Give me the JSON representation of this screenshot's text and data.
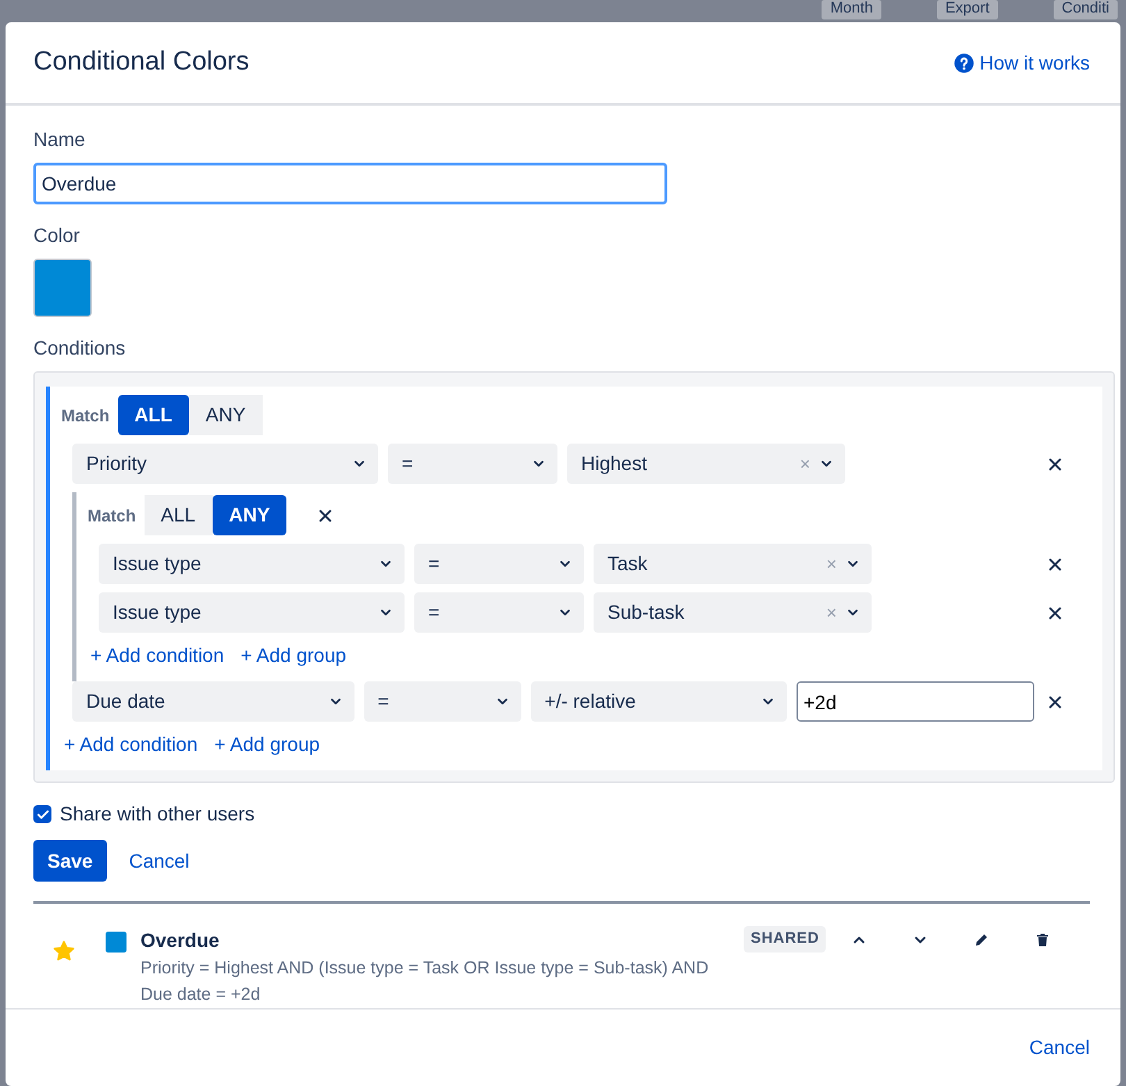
{
  "backdrop": {
    "toolbar": [
      "Month",
      "Export",
      "Conditi"
    ]
  },
  "dialog": {
    "title": "Conditional Colors",
    "help_link": "How it works"
  },
  "form": {
    "name_label": "Name",
    "name_value": "Overdue",
    "color_label": "Color",
    "color": "#0089d6",
    "conditions_label": "Conditions"
  },
  "group": {
    "match_label": "Match",
    "match_options": [
      {
        "label": "ALL",
        "selected": true
      },
      {
        "label": "ANY",
        "selected": false
      }
    ],
    "items": [
      {
        "kind": "condition",
        "field": "Priority",
        "operator": "=",
        "value": "Highest",
        "clear_icon": "×"
      },
      {
        "kind": "group",
        "match_label": "Match",
        "match_options": [
          {
            "label": "ALL",
            "selected": false
          },
          {
            "label": "ANY",
            "selected": true
          }
        ],
        "removable": true,
        "items": [
          {
            "kind": "condition",
            "field": "Issue type",
            "operator": "=",
            "value": "Task",
            "clear_icon": "×"
          },
          {
            "kind": "condition",
            "field": "Issue type",
            "operator": "=",
            "value": "Sub-task",
            "clear_icon": "×"
          }
        ],
        "add_condition": "+ Add condition",
        "add_group": "+ Add group"
      },
      {
        "kind": "condition",
        "field": "Due date",
        "operator": "=",
        "value": "+/- relative",
        "extra_input": "+2d"
      }
    ],
    "add_condition": "+ Add condition",
    "add_group": "+ Add group"
  },
  "share": {
    "label": "Share with other users",
    "checked": true
  },
  "actions": {
    "save": "Save",
    "cancel": "Cancel"
  },
  "saved_rules": [
    {
      "starred": true,
      "color": "#0089d6",
      "name": "Overdue",
      "badge": "SHARED",
      "description": "Priority = Highest AND (Issue type = Task OR Issue type = Sub-task) AND Due date = +2d"
    }
  ],
  "footer": {
    "cancel": "Cancel"
  }
}
